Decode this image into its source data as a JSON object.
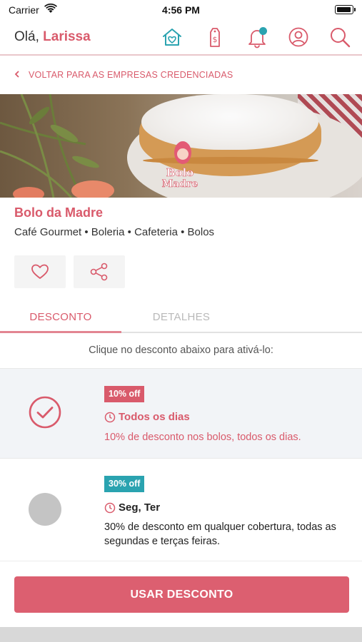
{
  "status_bar": {
    "carrier": "Carrier",
    "time": "4:56 PM"
  },
  "header": {
    "greeting": "Olá,",
    "user_name": "Larissa",
    "icons": [
      "home-icon",
      "price-tag-icon",
      "bell-icon",
      "user-icon",
      "search-icon"
    ],
    "notification_dot_color": "#2aa3b0"
  },
  "back_link": {
    "label": "VOLTAR PARA AS EMPRESAS CREDENCIADAS"
  },
  "company": {
    "name": "Bolo da Madre",
    "categories": "Café Gourmet • Boleria • Cafeteria • Bolos",
    "logo_text": "Bolo da Madre"
  },
  "actions": [
    "heart-icon",
    "share-icon"
  ],
  "tabs": [
    {
      "label": "DESCONTO",
      "active": true
    },
    {
      "label": "DETALHES",
      "active": false
    }
  ],
  "hint": "Clique no desconto abaixo para ativá-lo:",
  "discounts": [
    {
      "badge": "10% off",
      "days": "Todos os dias",
      "description": "10% de desconto nos bolos, todos os dias.",
      "selected": true,
      "badge_color": "#d95a6b"
    },
    {
      "badge": "30% off",
      "days": "Seg, Ter",
      "description": "30% de desconto em qualquer cobertura, todas as segundas e terças feiras.",
      "selected": false,
      "badge_color": "#2aa3b0"
    }
  ],
  "use_button": {
    "label": "USAR DESCONTO"
  },
  "colors": {
    "accent": "#d95a6b",
    "teal": "#2aa3b0",
    "button": "#dc5f70"
  }
}
